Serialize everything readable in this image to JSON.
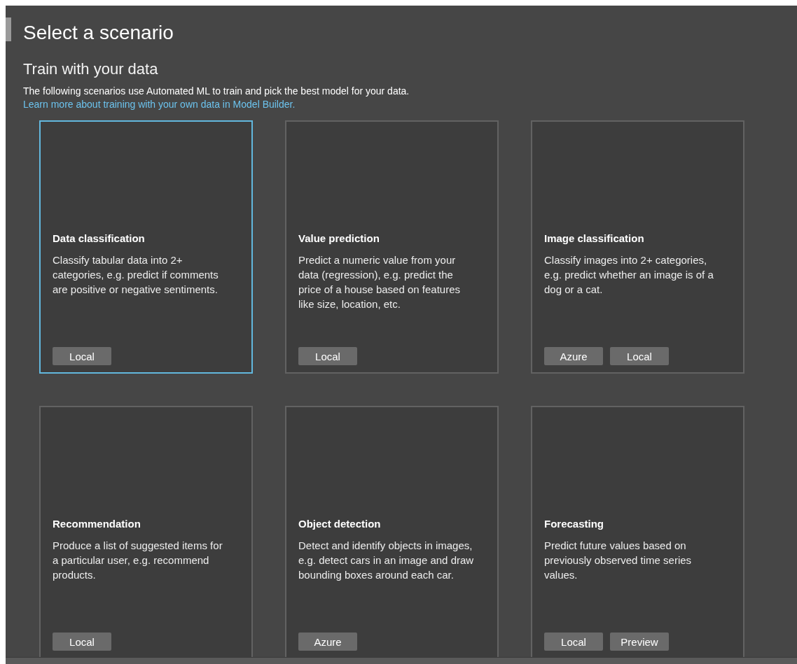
{
  "title": "Select a scenario",
  "section": {
    "heading": "Train with your data",
    "description": "The following scenarios use Automated ML to train and pick the best model for your data.",
    "link": "Learn more about training with your own data in Model Builder."
  },
  "scenarios": [
    {
      "title": "Data classification",
      "description": "Classify tabular data into 2+ categories, e.g. predict if comments are positive or negative sentiments.",
      "selected": true,
      "tags": [
        "Local"
      ]
    },
    {
      "title": "Value prediction",
      "description": "Predict a numeric value from your data (regression), e.g. predict the price of a house based on features like size, location, etc.",
      "selected": false,
      "tags": [
        "Local"
      ]
    },
    {
      "title": "Image classification",
      "description": "Classify images into 2+ categories, e.g. predict whether an image is of a dog or a cat.",
      "selected": false,
      "tags": [
        "Azure",
        "Local"
      ]
    },
    {
      "title": "Recommendation",
      "description": "Produce a list of suggested items for a particular user, e.g. recommend products.",
      "selected": false,
      "tags": [
        "Local"
      ]
    },
    {
      "title": "Object detection",
      "description": "Detect and identify objects in images, e.g. detect cars in an image and draw bounding boxes around each car.",
      "selected": false,
      "tags": [
        "Azure"
      ]
    },
    {
      "title": "Forecasting",
      "description": "Predict future values based on previously observed time series values.",
      "selected": false,
      "tags": [
        "Local",
        "Preview"
      ]
    }
  ]
}
